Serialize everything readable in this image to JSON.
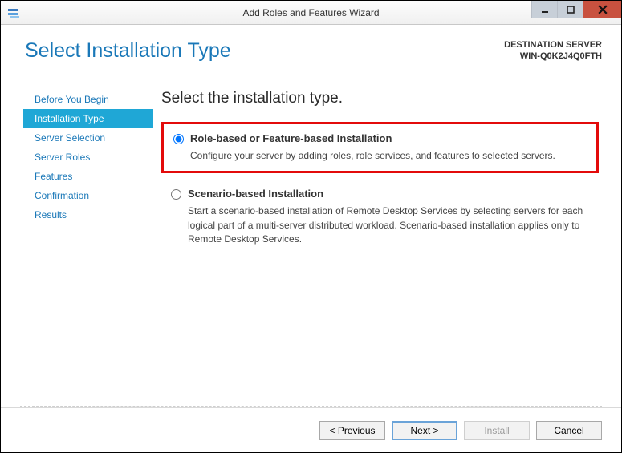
{
  "window": {
    "title": "Add Roles and Features Wizard"
  },
  "header": {
    "page_title": "Select Installation Type",
    "dest_label": "DESTINATION SERVER",
    "dest_name": "WIN-Q0K2J4Q0FTH"
  },
  "sidebar": {
    "items": [
      {
        "label": "Before You Begin"
      },
      {
        "label": "Installation Type"
      },
      {
        "label": "Server Selection"
      },
      {
        "label": "Server Roles"
      },
      {
        "label": "Features"
      },
      {
        "label": "Confirmation"
      },
      {
        "label": "Results"
      }
    ],
    "active_index": 1
  },
  "main": {
    "heading": "Select the installation type.",
    "options": [
      {
        "title": "Role-based or Feature-based Installation",
        "desc": "Configure your server by adding roles, role services, and features to selected servers.",
        "selected": true
      },
      {
        "title": "Scenario-based Installation",
        "desc": "Start a scenario-based installation of Remote Desktop Services by selecting servers for each logical part of a multi-server distributed workload. Scenario-based installation applies only to Remote Desktop Services.",
        "selected": false
      }
    ]
  },
  "footer": {
    "previous": "< Previous",
    "next": "Next >",
    "install": "Install",
    "cancel": "Cancel"
  }
}
